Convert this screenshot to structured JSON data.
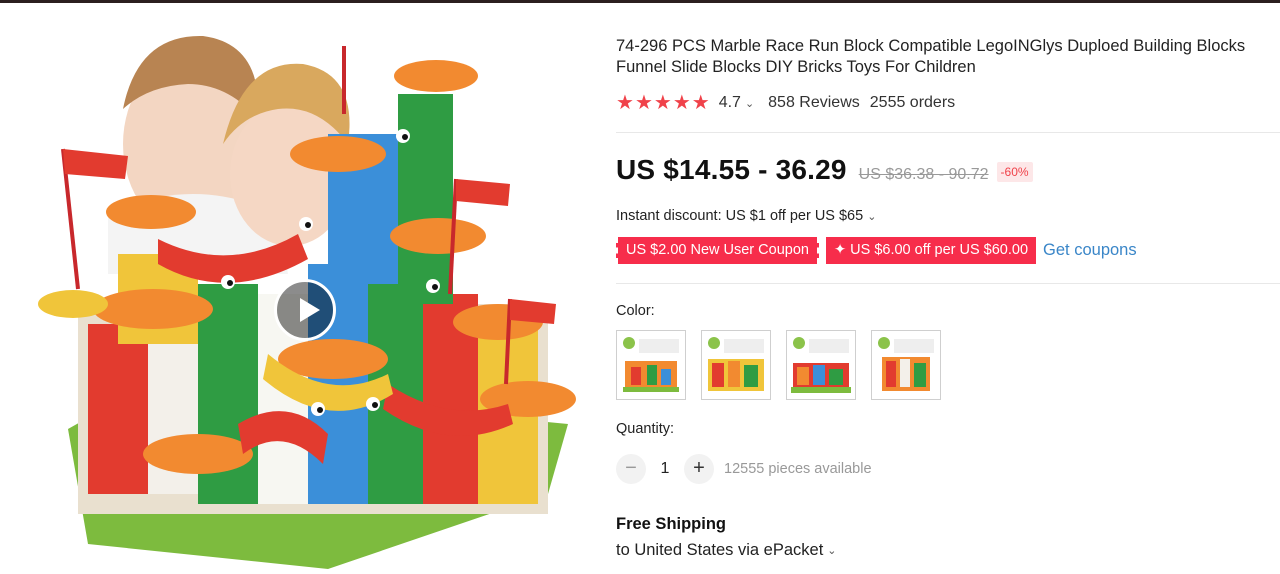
{
  "product": {
    "title": "74-296 PCS Marble Race Run Block Compatible LegoINGlys Duploed Building Blocks Funnel Slide Blocks DIY Bricks Toys For Children",
    "rating": "4.7",
    "rating_value": 4.7,
    "reviews": "858 Reviews",
    "orders": "2555 orders"
  },
  "price": {
    "current": "US $14.55 - 36.29",
    "original": "US $36.38 - 90.72",
    "discount": "-60%"
  },
  "instant_discount": "Instant discount: US $1 off per US $65",
  "coupons": {
    "new_user": "US $2.00 New User Coupon",
    "store": "✦ US $6.00 off per US $60.00",
    "get_link": "Get coupons"
  },
  "color": {
    "label": "Color:",
    "options": [
      "option-1",
      "option-2",
      "option-3",
      "option-4"
    ]
  },
  "quantity": {
    "label": "Quantity:",
    "value": "1",
    "minus": "−",
    "plus": "+",
    "available": "12555 pieces available"
  },
  "shipping": {
    "title": "Free Shipping",
    "destination": "to United States via ePacket"
  },
  "colors": {
    "star": "#f0424a",
    "coupon": "#f72d4b",
    "link": "#3a86c8"
  }
}
